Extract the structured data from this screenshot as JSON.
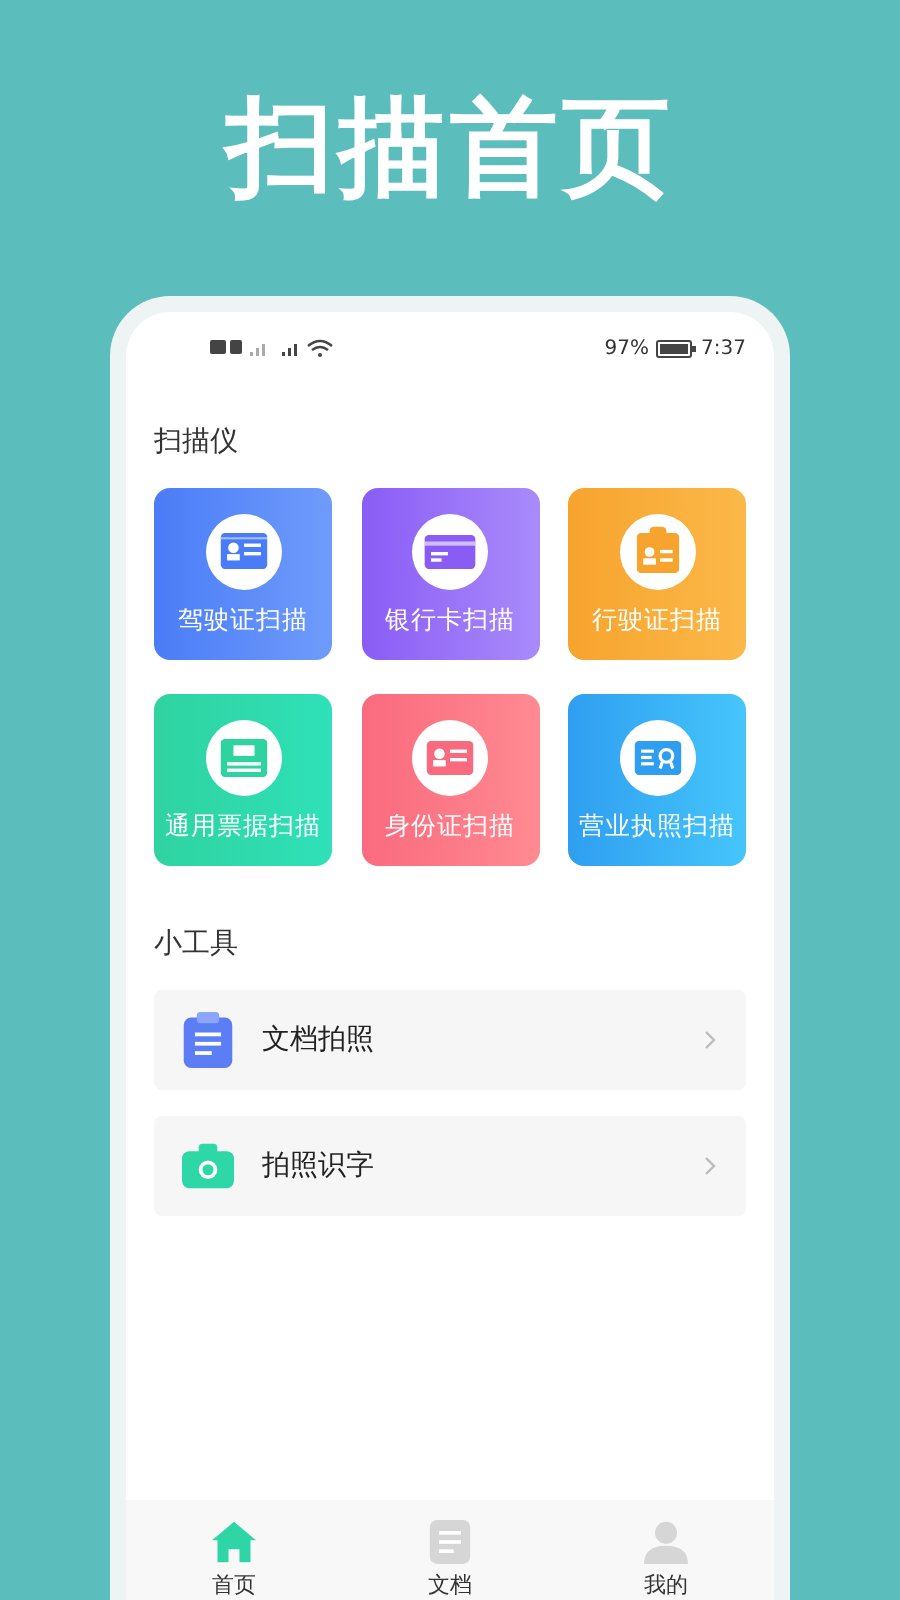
{
  "banner": {
    "title": "扫描首页"
  },
  "status_bar": {
    "battery": "97%",
    "time": "7:37"
  },
  "scanner": {
    "heading": "扫描仪",
    "tiles": [
      {
        "label": "驾驶证扫描"
      },
      {
        "label": "银行卡扫描"
      },
      {
        "label": "行驶证扫描"
      },
      {
        "label": "通用票据扫描"
      },
      {
        "label": "身份证扫描"
      },
      {
        "label": "营业执照扫描"
      }
    ]
  },
  "tools": {
    "heading": "小工具",
    "items": [
      {
        "label": "文档拍照"
      },
      {
        "label": "拍照识字"
      }
    ]
  },
  "tab_bar": [
    {
      "label": "首页",
      "selected": true
    },
    {
      "label": "文档",
      "selected": false
    },
    {
      "label": "我的",
      "selected": false
    }
  ]
}
